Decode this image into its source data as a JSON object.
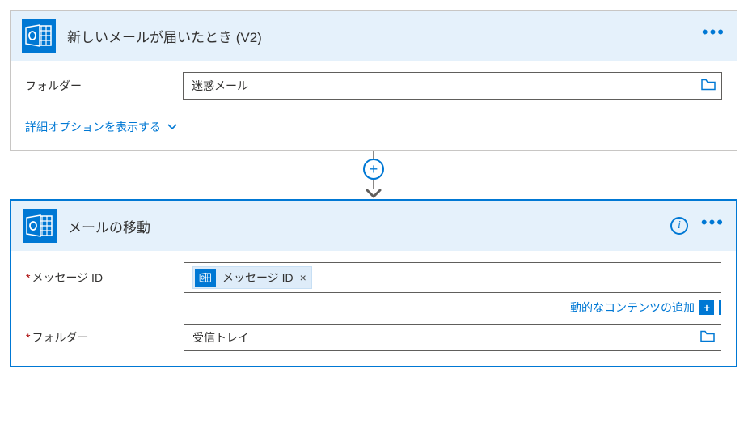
{
  "trigger": {
    "title": "新しいメールが届いたとき (V2)",
    "folder_label": "フォルダー",
    "folder_value": "迷惑メール",
    "advanced_label": "詳細オプションを表示する"
  },
  "action": {
    "title": "メールの移動",
    "message_id_label": "メッセージ ID",
    "message_id_token": "メッセージ ID",
    "dynamic_content_label": "動的なコンテンツの追加",
    "folder_label": "フォルダー",
    "folder_value": "受信トレイ"
  }
}
